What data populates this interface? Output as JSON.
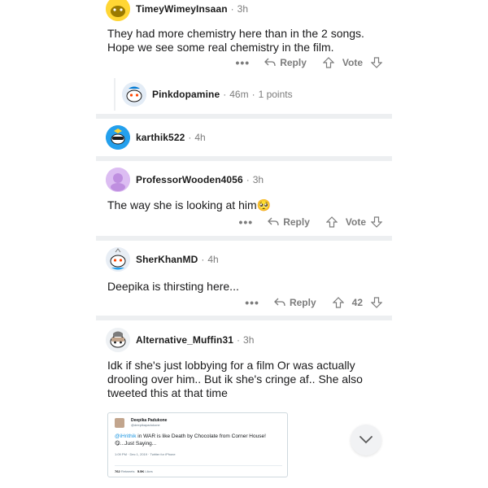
{
  "colors": {
    "separator": "#edeff1",
    "meta_gray": "#7c7c7c",
    "link_blue": "#1b95e0"
  },
  "comments": [
    {
      "username": "TimeyWimeyInsaan",
      "time": "3h",
      "body": "They had more chemistry here than in the 2 songs. Hope we see some real chemistry in the film.",
      "more_icon": "more-dots-icon",
      "reply_label": "Reply",
      "vote_label": "Vote"
    },
    {
      "username": "Pinkdopamine",
      "time": "46m",
      "points": "1 points"
    },
    {
      "username": "karthik522",
      "time": "4h"
    },
    {
      "username": "ProfessorWooden4056",
      "time": "3h",
      "body": "The way she is looking at him🥺",
      "reply_label": "Reply",
      "vote_label": "Vote"
    },
    {
      "username": "SherKhanMD",
      "time": "4h",
      "body": "Deepika is thirsting here...",
      "reply_label": "Reply",
      "vote_count": "42"
    },
    {
      "username": "Alternative_Muffin31",
      "time": "3h",
      "body": "Idk if she's just lobbying for a film Or was actually drooling over him.. But ik she's cringe af.. She also tweeted this at that time",
      "tweet": {
        "name": "Deepika Padukone",
        "handle": "@deepikapadukone",
        "mention": "@iHrithik",
        "text": " in WAR is like Death by Chocolate from Corner House! 😋...Just Saying...",
        "timestamp": "1:09 PM · Dec 1, 2019 · Twitter for iPhone",
        "retweets_num": "762",
        "retweets_label": "Retweets",
        "likes_num": "5.5K",
        "likes_label": "Likes"
      }
    }
  ],
  "separator_dot": "·"
}
